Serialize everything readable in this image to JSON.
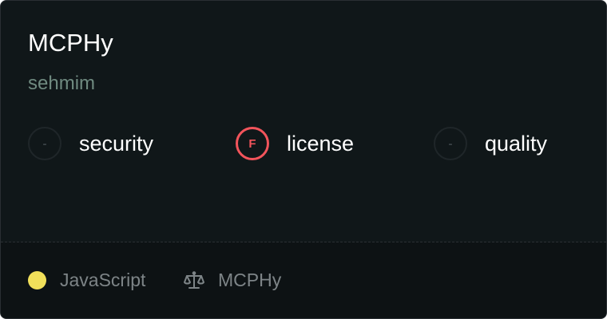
{
  "package": {
    "name": "MCPHy",
    "author": "sehmim"
  },
  "scores": [
    {
      "label": "security",
      "grade": "-",
      "status": "none"
    },
    {
      "label": "license",
      "grade": "F",
      "status": "fail"
    },
    {
      "label": "quality",
      "grade": "-",
      "status": "none"
    }
  ],
  "footer": {
    "language": "JavaScript",
    "language_color": "#f1e05a",
    "license_icon": "scale-icon",
    "license_text": "MCPHy"
  },
  "colors": {
    "background": "#101719",
    "fail": "#f2545b",
    "author": "#6f8a80"
  }
}
